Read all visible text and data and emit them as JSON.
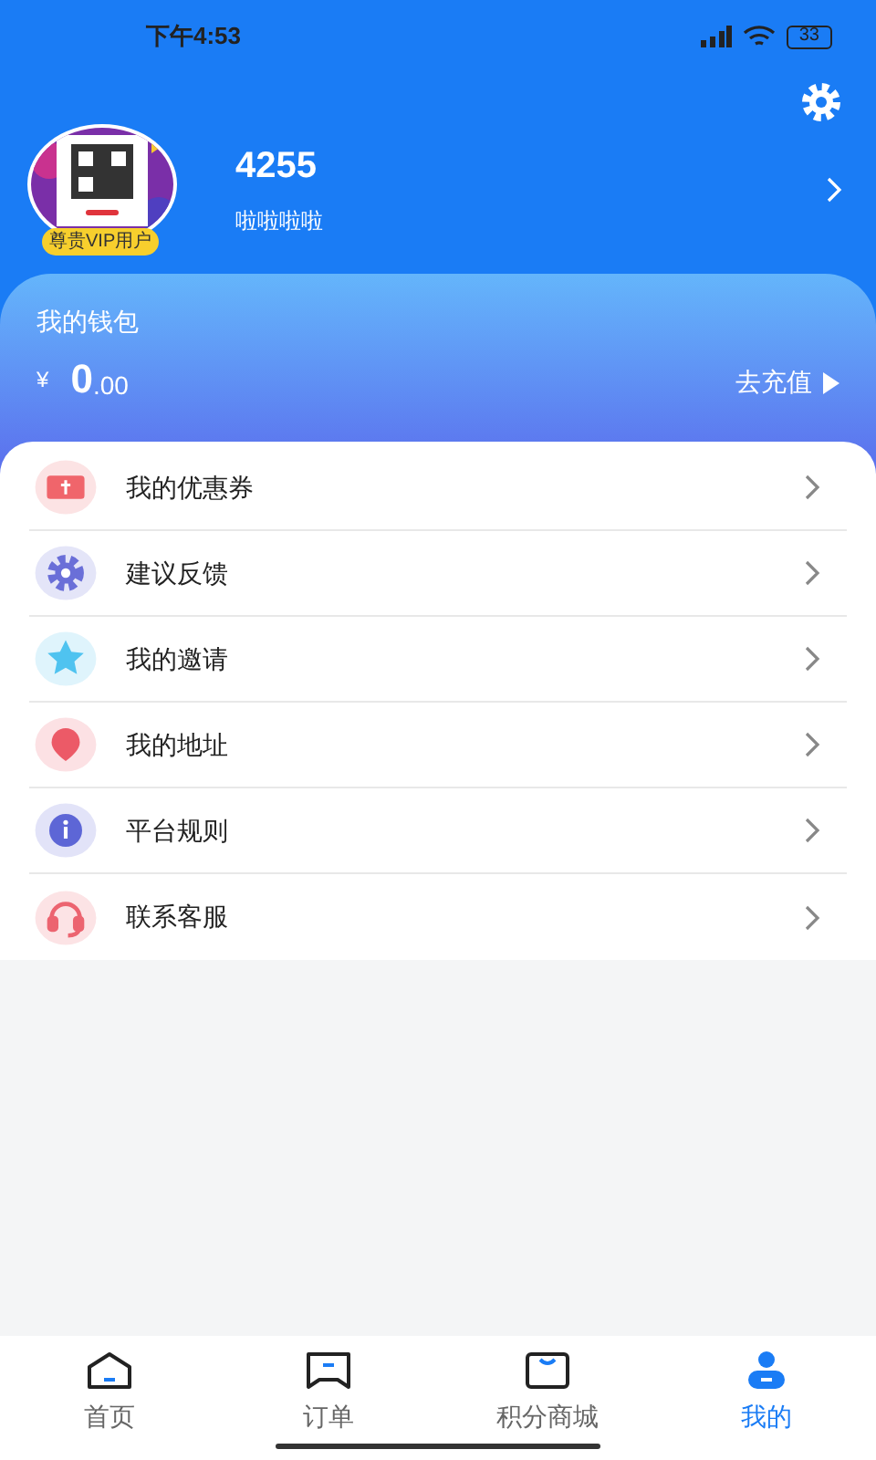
{
  "status_bar": {
    "time": "下午4:53",
    "battery": "33"
  },
  "profile": {
    "badge": "尊贵VIP用户",
    "name": "4255",
    "subtitle": "啦啦啦啦"
  },
  "wallet": {
    "title": "我的钱包",
    "currency": "¥",
    "amount": "0",
    "decimals": ".00",
    "recharge": "去充值"
  },
  "menu": [
    {
      "label": "我的优惠券",
      "kind": "coupon",
      "color": "#f0656b"
    },
    {
      "label": "建议反馈",
      "kind": "gear",
      "color": "#6a6fd8"
    },
    {
      "label": "我的邀请",
      "kind": "star",
      "color": "#4fc3f0"
    },
    {
      "label": "我的地址",
      "kind": "pin",
      "color": "#ec5a67"
    },
    {
      "label": "平台规则",
      "kind": "info",
      "color": "#5d66d6"
    },
    {
      "label": "联系客服",
      "kind": "headset",
      "color": "#ec6470"
    }
  ],
  "tabs": [
    {
      "label": "首页",
      "kind": "home",
      "selected": false
    },
    {
      "label": "订单",
      "kind": "order",
      "selected": false
    },
    {
      "label": "积分商城",
      "kind": "shop",
      "selected": false
    },
    {
      "label": "我的",
      "kind": "user",
      "selected": true
    }
  ]
}
